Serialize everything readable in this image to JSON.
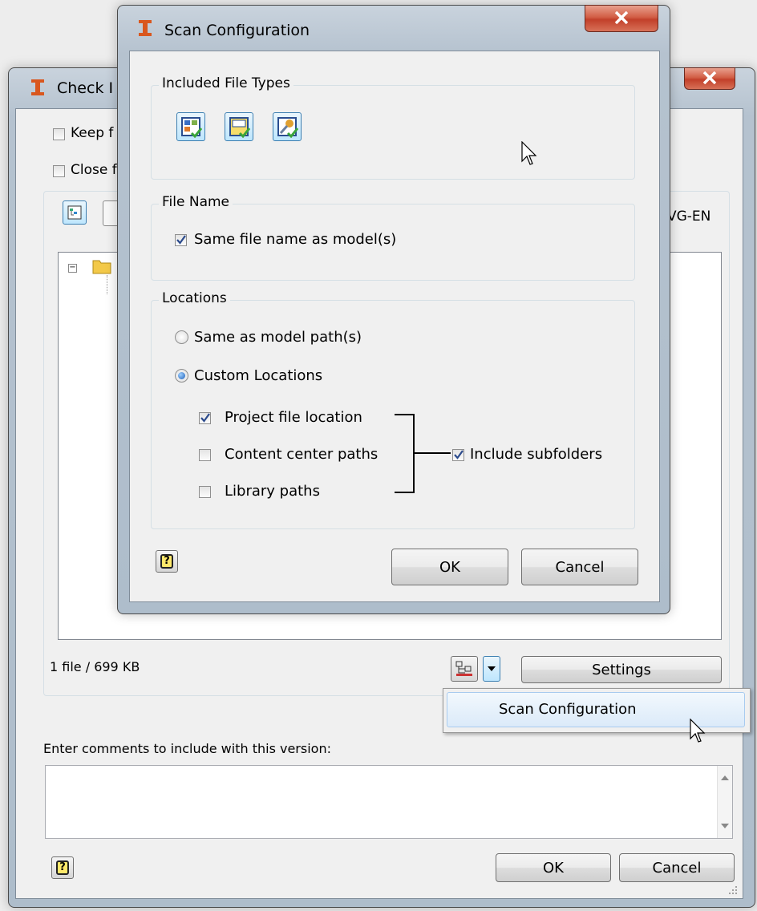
{
  "back_dialog": {
    "title": "Check I",
    "keep_label": "Keep f",
    "close_label": "Close f",
    "right_text": "VG-EN",
    "file_count": "1 file / 699 KB",
    "settings_label": "Settings",
    "comments_label": "Enter comments to include with this version:",
    "ok_label": "OK",
    "cancel_label": "Cancel"
  },
  "dropdown_menu": {
    "items": [
      "Scan Configuration"
    ]
  },
  "scan_dialog": {
    "title": "Scan Configuration",
    "included_file_types": {
      "title": "Included File Types",
      "icons": [
        "part-file-type-icon",
        "drawing-file-type-icon",
        "presentation-file-type-icon"
      ]
    },
    "file_name": {
      "title": "File Name",
      "same_name_label": "Same file name as model(s)",
      "same_name_checked": true
    },
    "locations": {
      "title": "Locations",
      "same_as_model_label": "Same as model path(s)",
      "custom_label": "Custom Locations",
      "selected": "Custom Locations",
      "project_file_label": "Project file location",
      "project_file_checked": true,
      "content_center_label": "Content center paths",
      "content_center_checked": false,
      "library_paths_label": "Library paths",
      "library_paths_checked": false,
      "include_subfolders_label": "Include subfolders",
      "include_subfolders_checked": true
    },
    "ok_label": "OK",
    "cancel_label": "Cancel"
  },
  "colors": {
    "close_button": "#c2402a",
    "menu_highlight": "#dbeaf9",
    "accent_blue": "#3c7fb1",
    "app_icon": "#d9571e"
  }
}
